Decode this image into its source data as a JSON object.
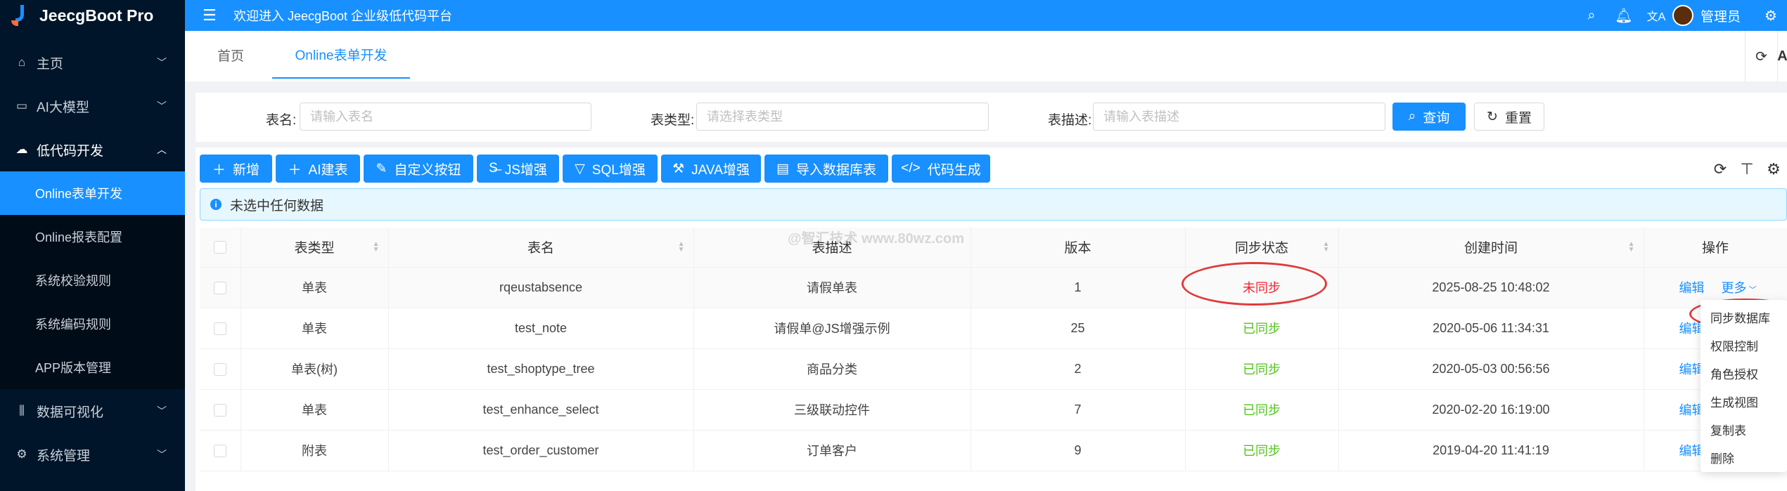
{
  "app": {
    "title": "JeecgBoot Pro"
  },
  "sidebar": {
    "items": [
      {
        "label": "主页",
        "icon": "home-icon"
      },
      {
        "label": "AI大模型",
        "icon": "ai-icon"
      },
      {
        "label": "低代码开发",
        "icon": "cloud-icon"
      }
    ],
    "submenu": [
      {
        "label": "Online表单开发"
      },
      {
        "label": "Online报表配置"
      },
      {
        "label": "系统校验规则"
      },
      {
        "label": "系统编码规则"
      },
      {
        "label": "APP版本管理"
      }
    ],
    "bottom": [
      {
        "label": "数据可视化",
        "icon": "chart-icon"
      },
      {
        "label": "系统管理",
        "icon": "gear-icon"
      }
    ]
  },
  "topbar": {
    "welcome": "欢迎进入 JeecgBoot 企业级低代码平台",
    "user": "管理员",
    "lang": "文A"
  },
  "tabs": [
    {
      "label": "首页"
    },
    {
      "label": "Online表单开发"
    }
  ],
  "tab_extra": "A",
  "search": {
    "name_label": "表名:",
    "name_placeholder": "请输入表名",
    "type_label": "表类型:",
    "type_placeholder": "请选择表类型",
    "desc_label": "表描述:",
    "desc_placeholder": "请输入表描述",
    "query": "查询",
    "reset": "重置"
  },
  "toolbar": {
    "add": "新增",
    "ai": "AI建表",
    "custom": "自定义按钮",
    "js": "JS增强",
    "sql": "SQL增强",
    "java": "JAVA增强",
    "import": "导入数据库表",
    "codegen": "代码生成"
  },
  "alert": {
    "text": "未选中任何数据"
  },
  "watermark": "@智汇技术 www.80wz.com",
  "table": {
    "headers": {
      "type": "表类型",
      "name": "表名",
      "desc": "表描述",
      "version": "版本",
      "sync": "同步状态",
      "created": "创建时间",
      "ops": "操作"
    },
    "rows": [
      {
        "type": "单表",
        "name": "rqeustabsence",
        "desc": "请假单表",
        "version": "1",
        "sync": "未同步",
        "created": "2025-08-25 10:48:02",
        "edit": "编辑",
        "more": "更多"
      },
      {
        "type": "单表",
        "name": "test_note",
        "desc": "请假单@JS增强示例",
        "version": "25",
        "sync": "已同步",
        "created": "2020-05-06 11:34:31",
        "edit": "编辑"
      },
      {
        "type": "单表(树)",
        "name": "test_shoptype_tree",
        "desc": "商品分类",
        "version": "2",
        "sync": "已同步",
        "created": "2020-05-03 00:56:56",
        "edit": "编辑"
      },
      {
        "type": "单表",
        "name": "test_enhance_select",
        "desc": "三级联动控件",
        "version": "7",
        "sync": "已同步",
        "created": "2020-02-20 16:19:00",
        "edit": "编辑"
      },
      {
        "type": "附表",
        "name": "test_order_customer",
        "desc": "订单客户",
        "version": "9",
        "sync": "已同步",
        "created": "2019-04-20 11:41:19",
        "edit": "编辑"
      }
    ]
  },
  "dropdown": {
    "items": [
      "同步数据库",
      "权限控制",
      "角色授权",
      "生成视图",
      "复制表",
      "删除"
    ]
  },
  "colors": {
    "primary": "#1890ff",
    "sidebar": "#001529",
    "unsynced": "#f5222d",
    "synced": "#52c41a",
    "annotation": "#e03a3a"
  }
}
